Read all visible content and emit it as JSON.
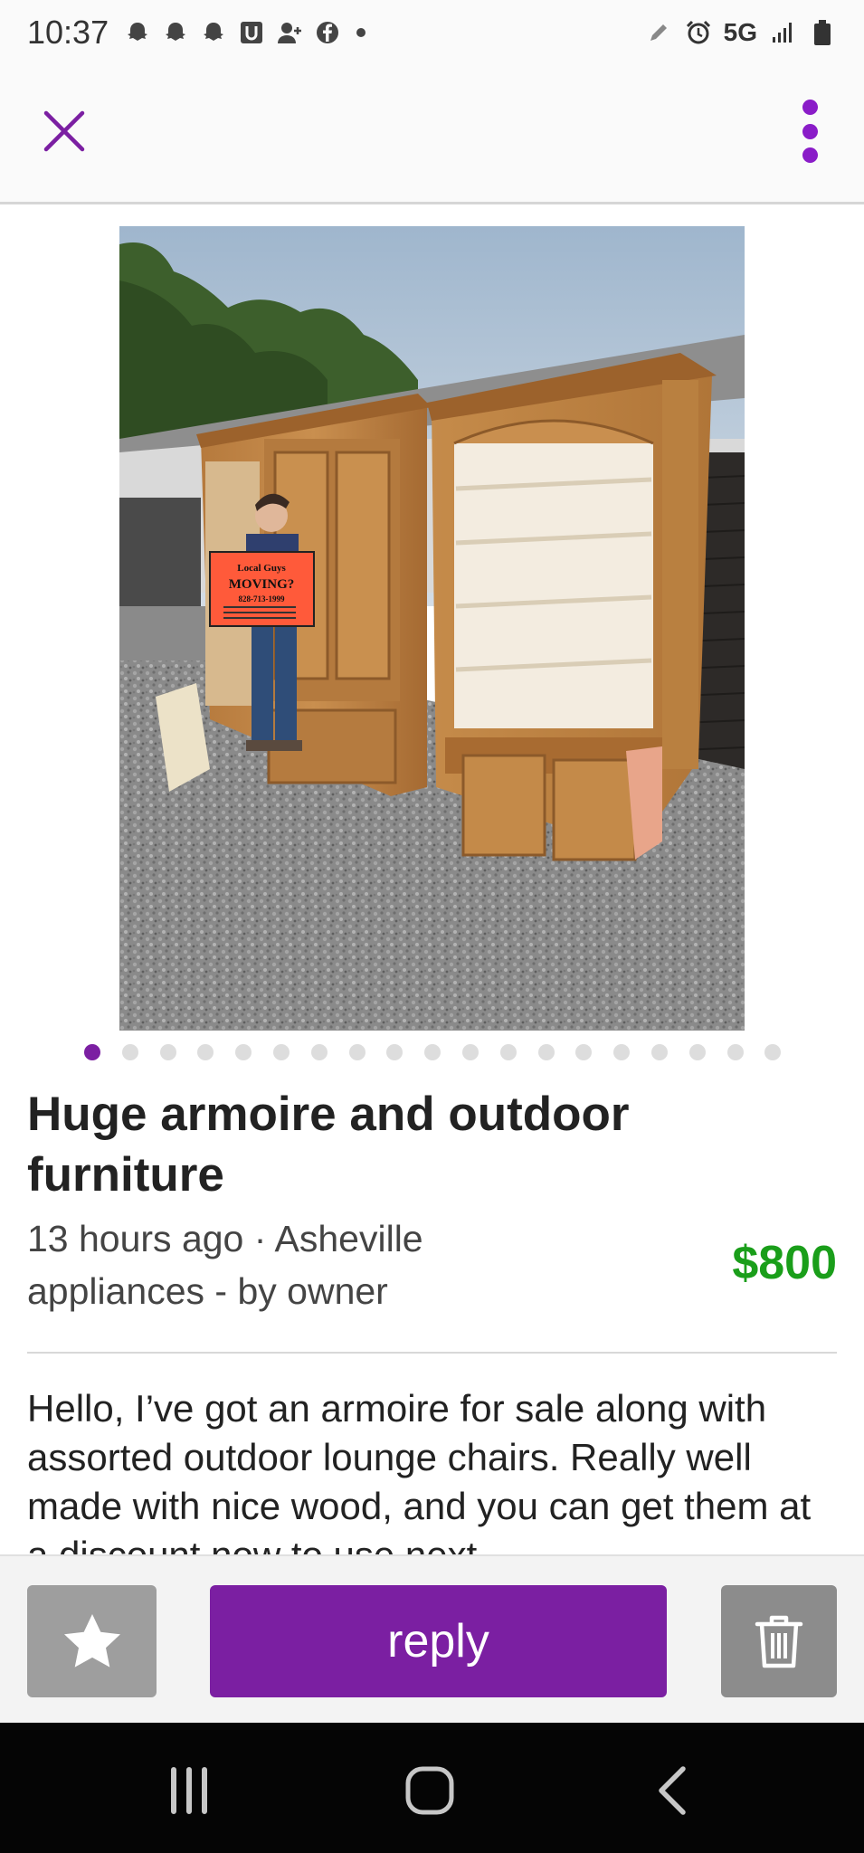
{
  "status_bar": {
    "time": "10:37",
    "notification_icons": [
      "snapchat-icon",
      "snapchat-icon",
      "snapchat-icon",
      "u-app-icon",
      "person-add-icon",
      "facebook-icon"
    ],
    "network": "5G",
    "right_icons": [
      "pen-icon",
      "alarm-icon",
      "signal-icon",
      "battery-icon"
    ]
  },
  "app_bar": {
    "close_icon": "close-icon",
    "more_icon": "more-vertical-icon"
  },
  "photo": {
    "sign_lines": [
      "Local Guys",
      "MOVING?",
      "828-713-1999"
    ],
    "pager_total": 19,
    "pager_active_index": 0
  },
  "listing": {
    "title": "Huge armoire and outdoor furniture",
    "posted": "13 hours ago · Asheville",
    "category": "appliances - by owner",
    "price": "$800",
    "body": "Hello, I’ve got an armoire for sale along with assorted outdoor lounge chairs. Really well made with nice wood, and you can get them at a discount now to use next"
  },
  "actions": {
    "favorite_icon": "star-icon",
    "reply_label": "reply",
    "delete_icon": "trash-icon"
  },
  "nav_bar": {
    "icons": [
      "recent-apps-icon",
      "home-icon",
      "back-icon"
    ]
  },
  "colors": {
    "accent": "#7b1fa2",
    "price": "#1a9e1a",
    "button_grey": "#9e9e9e"
  }
}
